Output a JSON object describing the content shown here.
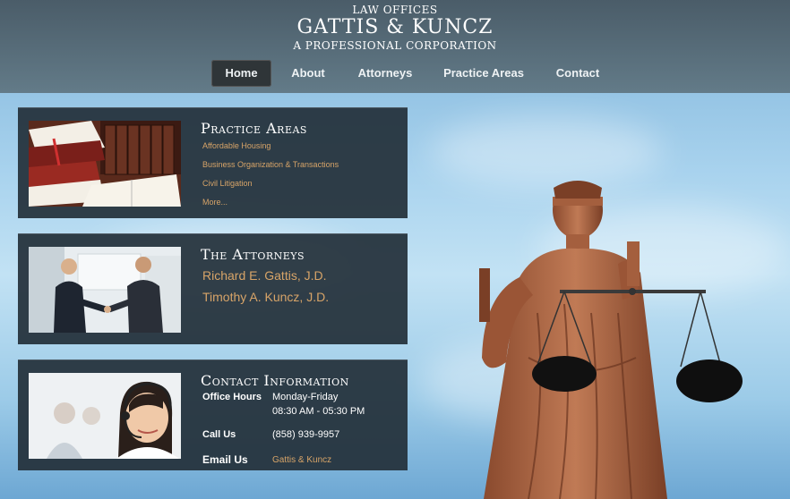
{
  "header": {
    "logo_line1": "LAW OFFICES",
    "logo_line2": "GATTIS & KUNCZ",
    "logo_line3": "A PROFESSIONAL CORPORATION"
  },
  "nav": {
    "items": [
      {
        "label": "Home",
        "active": true
      },
      {
        "label": "About",
        "active": false
      },
      {
        "label": "Attorneys",
        "active": false
      },
      {
        "label": "Practice Areas",
        "active": false
      },
      {
        "label": "Contact",
        "active": false
      }
    ]
  },
  "practice_panel": {
    "title": "Practice Areas",
    "links": [
      "Affordable Housing",
      "Business Organization & Transactions",
      "Civil Litigation",
      "More..."
    ],
    "image": "law-books-image"
  },
  "attorneys_panel": {
    "title": "The Attorneys",
    "attorneys": [
      "Richard E. Gattis, J.D.",
      "Timothy A. Kuncz, J.D."
    ],
    "image": "handshake-image"
  },
  "contact_panel": {
    "title": "Contact Information",
    "office_hours_label": "Office Hours",
    "office_hours_days": "Monday-Friday",
    "office_hours_time": "08:30 AM - 05:30 PM",
    "call_label": "Call Us",
    "phone": "(858) 939-9957",
    "email_label": "Email Us",
    "email_link": "Gattis & Kuncz",
    "image": "headset-operator-image"
  },
  "colors": {
    "accent_link": "#d7a468",
    "panel_bg": "#23303a",
    "header_bg": "#46555f",
    "nav_active": "#2f3538"
  }
}
